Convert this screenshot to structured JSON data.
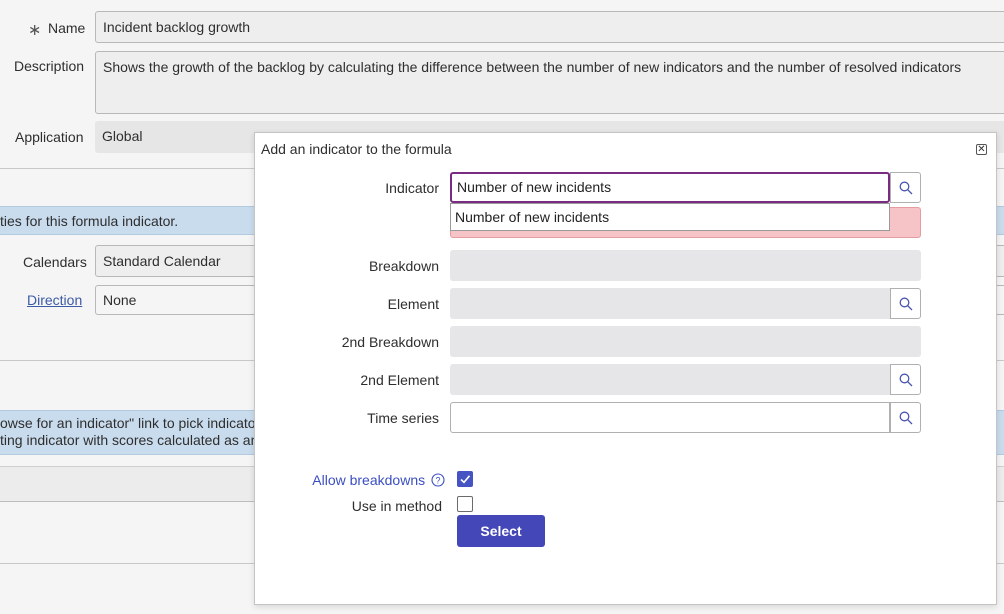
{
  "form": {
    "required_mark": "∗",
    "name_label": "Name",
    "name_value": "Incident backlog growth",
    "description_label": "Description",
    "description_value": "Shows the growth of the backlog by calculating the difference between the number of new indicators and the number of resolved indicators",
    "application_label": "Application",
    "application_value": "Global",
    "info_banner_text": "ties for this formula indicator.",
    "calendars_label": "Calendars",
    "calendars_value": "Standard Calendar",
    "direction_label": "Direction",
    "direction_value": "None",
    "help_line1": "owse for an indicator\" link to pick indicato",
    "help_line2": "ting indicator with scores calculated as an"
  },
  "dialog": {
    "title": "Add an indicator to the formula",
    "close_icon": "close-x-icon",
    "indicator_label": "Indicator",
    "indicator_value": "Number of new incidents",
    "suggestion_item": "Number of new incidents",
    "breakdown_label": "Breakdown",
    "element_label": "Element",
    "breakdown2_label": "2nd Breakdown",
    "element2_label": "2nd Element",
    "time_series_label": "Time series",
    "allow_breakdowns_label": "Allow breakdowns",
    "allow_breakdowns_checked": true,
    "use_in_method_label": "Use in method",
    "use_in_method_checked": false,
    "select_label": "Select"
  },
  "colors": {
    "accent": "#4447b8",
    "link": "#3c5aa6",
    "info_band": "#c9dcee",
    "error_band": "#f6c4c6"
  }
}
